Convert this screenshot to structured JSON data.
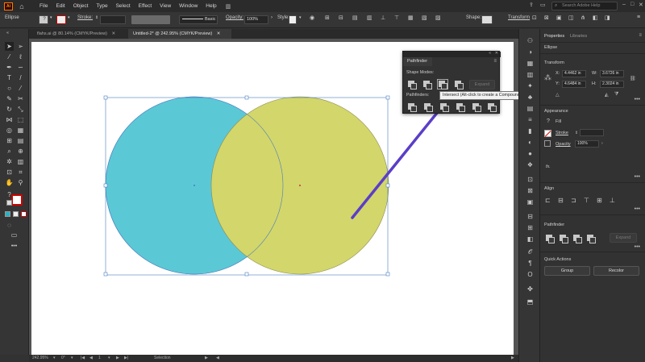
{
  "app": {
    "logo": "Ai",
    "menu": [
      "File",
      "Edit",
      "Object",
      "Type",
      "Select",
      "Effect",
      "View",
      "Window",
      "Help"
    ],
    "search_placeholder": "Search Adobe Help"
  },
  "control_bar": {
    "object_type": "Ellipse",
    "stroke_label": "Stroke:",
    "brush_label": "Basic",
    "opacity_label": "Opacity:",
    "opacity_value": "100%",
    "style_label": "Style:",
    "shape_label": "Shape:",
    "transform_label": "Transform"
  },
  "tabs": [
    {
      "label": "flahs.ai @ 80.14% (CMYK/Preview)",
      "active": false
    },
    {
      "label": "Untitled-2* @ 242.95% (CMYK/Preview)",
      "active": true
    }
  ],
  "status_bar": {
    "zoom": "242.95%",
    "rotation": "0°",
    "artboard": "1",
    "tool": "Selection"
  },
  "artwork": {
    "circle_left_color": "#5bc8d6",
    "circle_right_color": "#d3d66a",
    "arrow_color": "#5b3ec8"
  },
  "pathfinder_panel": {
    "title": "Pathfinder",
    "shape_modes_label": "Shape Modes:",
    "expand_label": "Expand",
    "pathfinders_label": "Pathfinders:"
  },
  "tooltip": "Intersect (Alt-click to create a Compound Shape and intersect shape area)",
  "properties_panel": {
    "tabs": [
      "Properties",
      "Libraries"
    ],
    "object_type": "Ellipse",
    "transform": {
      "title": "Transform",
      "x_label": "X:",
      "x_value": "4.4462 in",
      "y_label": "Y:",
      "y_value": "4.6484 in",
      "w_label": "W:",
      "w_value": "3.6726 in",
      "h_label": "H:",
      "h_value": "2.3024 in"
    },
    "appearance": {
      "title": "Appearance",
      "fill_label": "Fill",
      "stroke_label": "Stroke",
      "opacity_label": "Opacity",
      "opacity_value": "100%",
      "fx_label": "fx."
    },
    "align_title": "Align",
    "pathfinder": {
      "title": "Pathfinder",
      "expand_label": "Expand"
    },
    "quick_actions": {
      "title": "Quick Actions",
      "group_label": "Group",
      "recolor_label": "Recolor"
    }
  }
}
